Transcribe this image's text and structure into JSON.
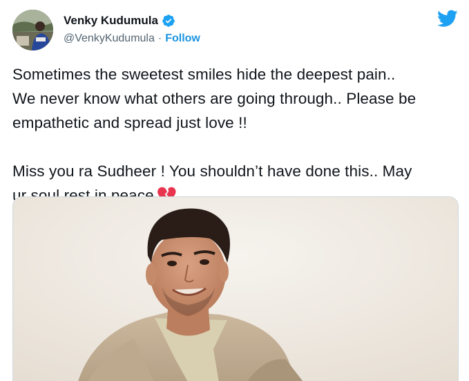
{
  "author": {
    "display_name": "Venky Kudumula",
    "handle": "@VenkyKudumula",
    "separator": "·",
    "follow_label": "Follow"
  },
  "icons": {
    "verified": "verified-badge-icon",
    "brand": "twitter-bird-icon",
    "emoji": "broken-heart-icon"
  },
  "tweet": {
    "paragraph_1": "Sometimes the sweetest smiles hide the deepest pain..\nWe never know what others are going through.. Please be\nempathetic and spread just love !!",
    "paragraph_2": "Miss you ra Sudheer ! You shouldn’t have done this.. May\nur soul rest in peace"
  },
  "colors": {
    "accent": "#1da1f2",
    "follow_link": "#1b95e0",
    "text": "#0f1419",
    "muted": "#536471",
    "heart": "#e8344e"
  }
}
